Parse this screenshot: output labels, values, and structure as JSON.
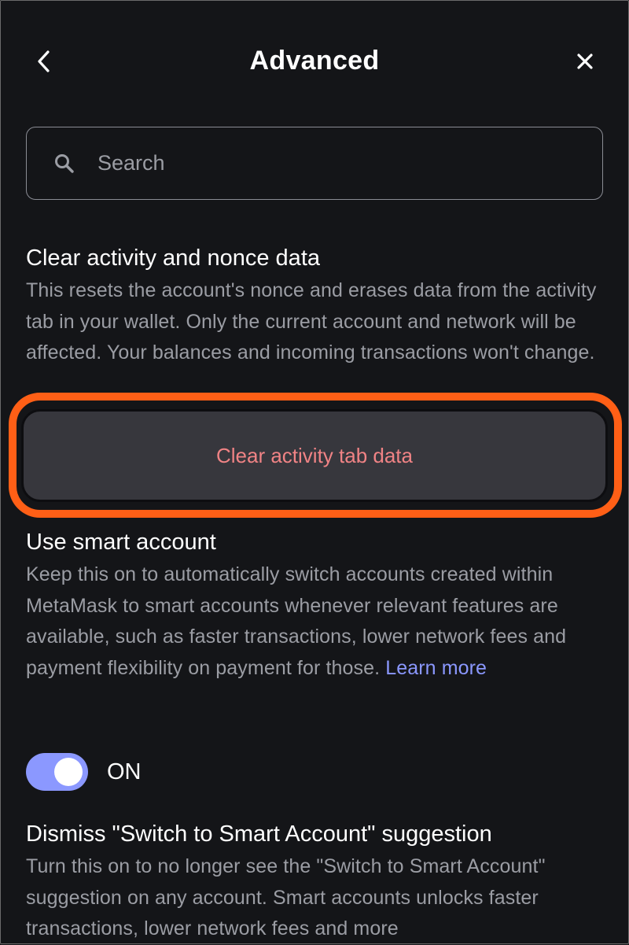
{
  "header": {
    "title": "Advanced",
    "back_icon": "chevron-left-icon",
    "close_icon": "close-icon"
  },
  "search": {
    "placeholder": "Search",
    "value": "",
    "icon": "search-icon"
  },
  "clear_activity": {
    "title": "Clear activity and nonce data",
    "description": "This resets the account's nonce and erases data from the activity tab in your wallet. Only the current account and network will be affected. Your balances and incoming transactions won't change.",
    "button_label": "Clear activity tab data"
  },
  "smart_account": {
    "title": "Use smart account",
    "description": "Keep this on to automatically switch accounts created within MetaMask to smart accounts whenever relevant features are available, such as faster transactions, lower network fees and payment flexibility on payment for those.",
    "link_label": "Learn more",
    "toggle_state": "ON"
  },
  "dismiss_suggestion": {
    "title": "Dismiss \"Switch to Smart Account\" suggestion",
    "description": "Turn this on to no longer see the \"Switch to Smart Account\" suggestion on any account. Smart accounts unlocks faster transactions, lower network fees and more"
  },
  "colors": {
    "background": "#141518",
    "accent": "#8b98ff",
    "danger_text": "#f08385",
    "highlight": "#ff5f16"
  }
}
